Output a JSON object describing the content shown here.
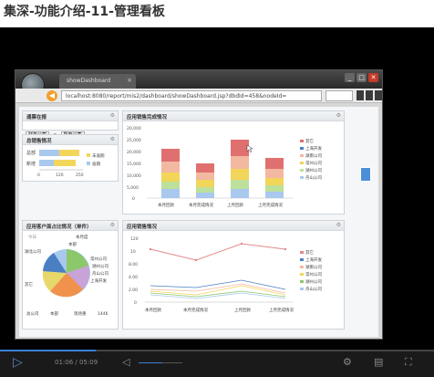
{
  "page_title": "集深-功能介绍-11-管理看板",
  "browser": {
    "tab_title": "showDashboard",
    "url": "localhost:8080/report/mis2/dashboard/showDashboard.jsp?dbdId=458&nodeId=",
    "window_buttons": [
      "_",
      "□",
      "✕"
    ]
  },
  "dashboard": {
    "filter_panel": {
      "title": "通票在报",
      "select1": "财务公司",
      "select2": "所有公司"
    },
    "sales_panel": {
      "title": "总销售情况",
      "categories": [
        "总部",
        "新增"
      ],
      "axis_ticks": [
        "0",
        "120",
        "250"
      ],
      "legend": [
        "未逾期",
        "逾期"
      ]
    },
    "income_panel": {
      "title": "应用销售完成情况",
      "y_ticks": [
        "20,000",
        "25,000",
        "20,000",
        "15,000",
        "10,000",
        "5,000",
        "0"
      ],
      "x_labels": [
        "本月回款",
        "本月完成情况",
        "上月回款",
        "上月完成情况"
      ],
      "legend": [
        "其它",
        "上海开发",
        "湖南公司",
        "常州公司",
        "湖州公司",
        "舟山公司"
      ]
    },
    "pie_panel": {
      "title": "应用客户面占比情况（单件）",
      "sub_tabs": [
        "今日",
        "本月度"
      ],
      "labels": [
        "湖北公司",
        "本部",
        "常州公司",
        "湖州公司",
        "舟山公司",
        "上海开发",
        "其它"
      ],
      "bottom_labels": [
        "总公司",
        "本部",
        "现场重",
        "1446"
      ]
    },
    "line_panel": {
      "title": "应用销售情况",
      "y_ticks": [
        "120",
        "10",
        "8.00",
        "4.00",
        "2.00",
        "0"
      ],
      "x_labels": [
        "本月回款",
        "本月完成情况",
        "上月回款",
        "上月完成情况"
      ],
      "legend": [
        "其它",
        "上海开发",
        "湖南公司",
        "常州公司",
        "湖州公司",
        "舟山公司"
      ]
    }
  },
  "player": {
    "time": "01:06 / 05:09",
    "progress": 0.22,
    "volume": 0.55
  },
  "colors": {
    "player_bg": "#000000",
    "accent": "#3d7fd6",
    "bar_red": "#e06060",
    "bar_yellow": "#f2d65a",
    "bar_green": "#8cc86a"
  }
}
